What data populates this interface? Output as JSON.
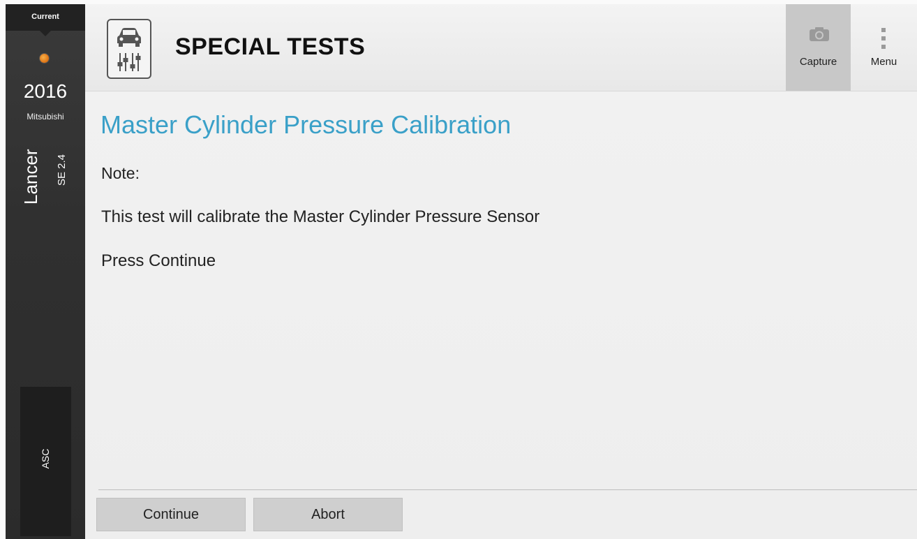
{
  "sidebar": {
    "current_label": "Current",
    "year": "2016",
    "make": "Mitsubishi",
    "model": "Lancer",
    "trim": "SE 2.4",
    "module": "ASC",
    "status_dot_color": "#e27a1a"
  },
  "header": {
    "title": "SPECIAL TESTS",
    "app_icon": "car-special-tests-icon",
    "capture_label": "Capture",
    "capture_icon": "camera-icon",
    "menu_label": "Menu",
    "menu_icon": "vertical-dots-icon"
  },
  "main": {
    "section_title": "Master Cylinder Pressure Calibration",
    "note_label": "Note:",
    "message": "This test will calibrate the Master Cylinder Pressure Sensor",
    "instruction": "Press Continue",
    "title_color": "#3aa0c8"
  },
  "footer": {
    "continue_label": "Continue",
    "abort_label": "Abort"
  }
}
